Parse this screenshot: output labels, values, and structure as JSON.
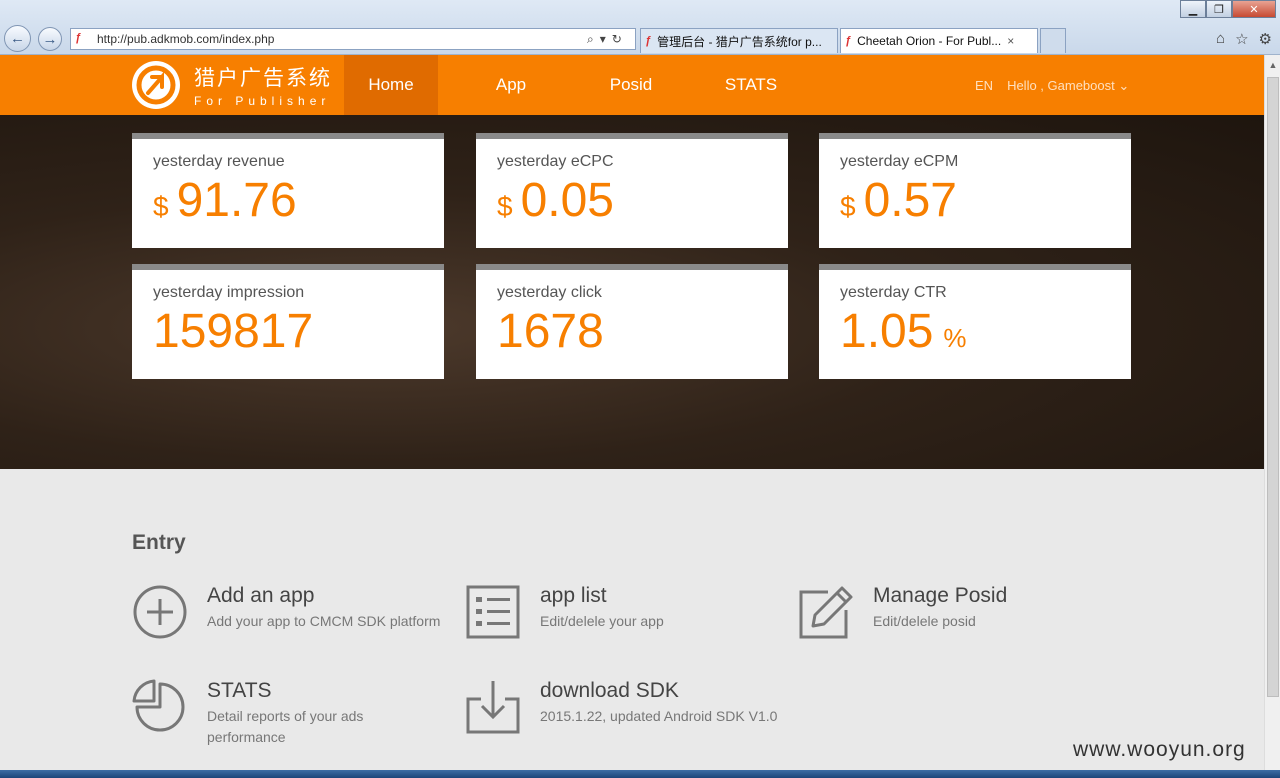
{
  "browser": {
    "url": "http://pub.adkmob.com/index.php",
    "tabs": [
      {
        "label": "管理后台 - 猎户广告系统for p..."
      },
      {
        "label": "Cheetah Orion - For Publ..."
      }
    ]
  },
  "header": {
    "logo_title": "猎户广告系统",
    "logo_subtitle": "For Publisher",
    "nav": [
      "Home",
      "App",
      "Posid",
      "STATS"
    ],
    "lang": "EN",
    "greeting": "Hello , Gameboost"
  },
  "stats": {
    "revenue": {
      "label": "yesterday revenue",
      "currency": "$",
      "value": "91.76"
    },
    "ecpc": {
      "label": "yesterday eCPC",
      "currency": "$",
      "value": "0.05"
    },
    "ecpm": {
      "label": "yesterday eCPM",
      "currency": "$",
      "value": "0.57"
    },
    "impression": {
      "label": "yesterday impression",
      "value": "159817"
    },
    "click": {
      "label": "yesterday click",
      "value": "1678"
    },
    "ctr": {
      "label": "yesterday CTR",
      "value": "1.05",
      "unit": "%"
    }
  },
  "entry": {
    "title": "Entry",
    "items": [
      {
        "title": "Add an app",
        "desc": "Add your app to CMCM SDK platform",
        "icon": "plus-circle-icon"
      },
      {
        "title": "app list",
        "desc": "Edit/delele your app",
        "icon": "list-icon"
      },
      {
        "title": "Manage Posid",
        "desc": "Edit/delele posid",
        "icon": "edit-icon"
      },
      {
        "title": "STATS",
        "desc": "Detail reports of your ads performance",
        "icon": "pie-chart-icon"
      },
      {
        "title": "download SDK",
        "desc": "2015.1.22, updated Android SDK V1.0",
        "icon": "download-icon"
      }
    ]
  },
  "watermark": "www.wooyun.org",
  "colors": {
    "brand": "#f77f00",
    "brand_dark": "#e06b00"
  }
}
